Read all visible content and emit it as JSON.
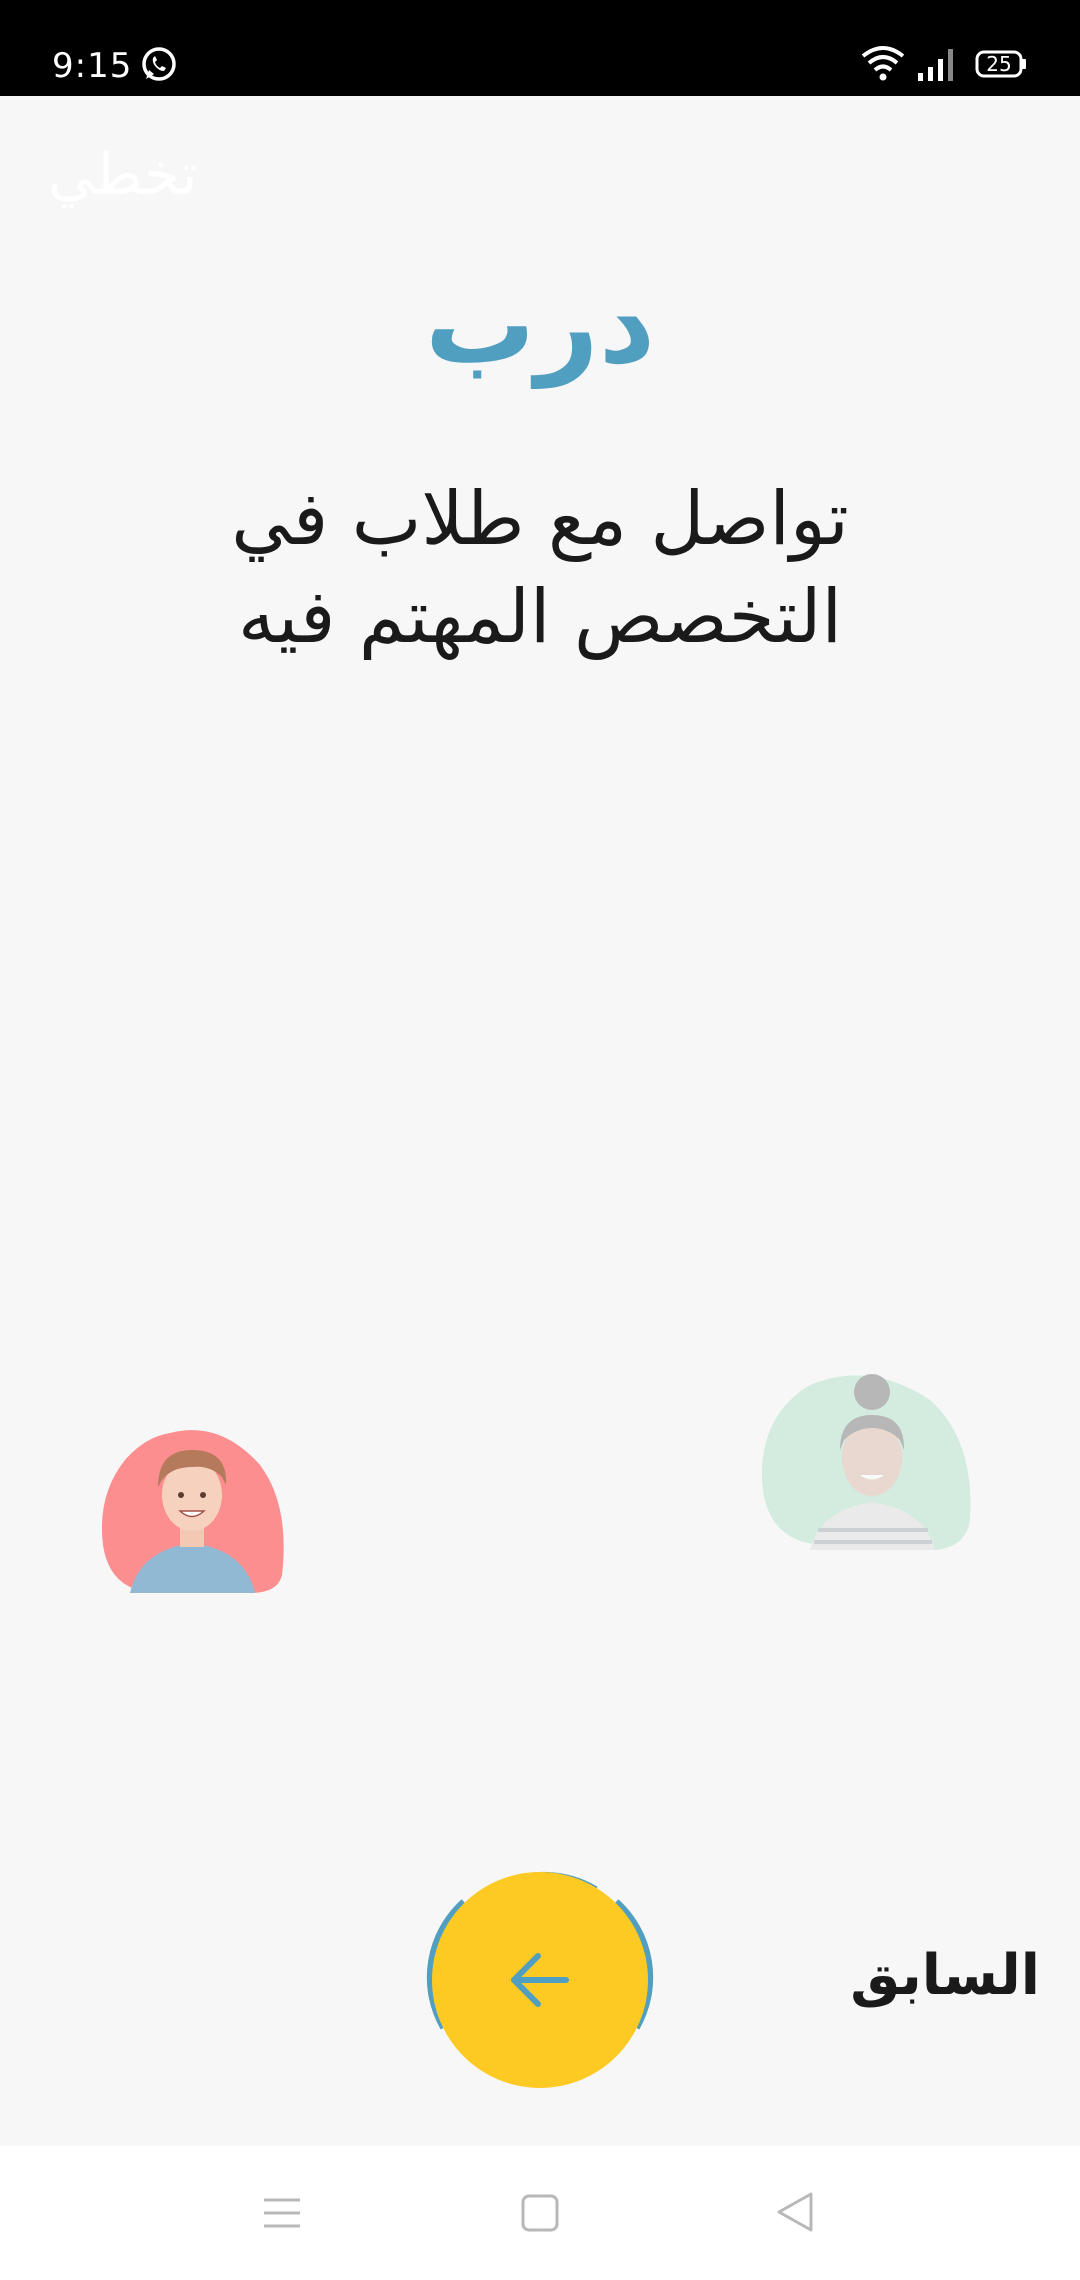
{
  "status_bar": {
    "time": "9:15",
    "battery": "25",
    "icons": [
      "whatsapp-icon",
      "wifi-icon",
      "signal-icon",
      "battery-icon"
    ]
  },
  "header": {
    "skip_label": "تخطي"
  },
  "main": {
    "title": "درب",
    "subtitle_line1": "تواصل مع طلاب في",
    "subtitle_line2": "التخصص المهتم فيه"
  },
  "footer": {
    "previous_label": "السابق",
    "next_icon": "arrow-left-icon"
  },
  "nav": {
    "icons": [
      "menu-icon",
      "home-icon",
      "back-icon"
    ]
  },
  "colors": {
    "accent": "#519fc0",
    "button": "#fdca24",
    "text": "#1a1a1a",
    "background": "#f7f7f7"
  }
}
